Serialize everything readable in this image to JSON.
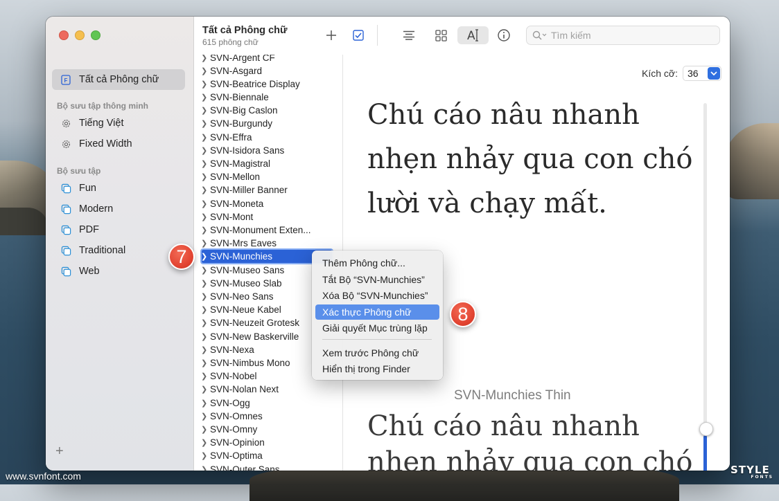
{
  "sidebar": {
    "all_fonts": "Tất cả Phông chữ",
    "smart_header": "Bộ sưu tập thông minh",
    "smart_items": [
      "Tiếng Việt",
      "Fixed Width"
    ],
    "collections_header": "Bộ sưu tập",
    "collections": [
      "Fun",
      "Modern",
      "PDF",
      "Traditional",
      "Web"
    ],
    "add_label": "+"
  },
  "toolbar": {
    "title": "Tất cả Phông chữ",
    "subtitle": "615 phông chữ",
    "search_placeholder": "Tìm kiếm"
  },
  "font_list": [
    "SVN-Argent CF",
    "SVN-Asgard",
    "SVN-Beatrice Display",
    "SVN-Biennale",
    "SVN-Big Caslon",
    "SVN-Burgundy",
    "SVN-Effra",
    "SVN-Isidora Sans",
    "SVN-Magistral",
    "SVN-Mellon",
    "SVN-Miller Banner",
    "SVN-Moneta",
    "SVN-Mont",
    "SVN-Monument Exten...",
    "SVN-Mrs Eaves",
    "SVN-Munchies",
    "SVN-Museo Sans",
    "SVN-Museo Slab",
    "SVN-Neo Sans",
    "SVN-Neue Kabel",
    "SVN-Neuzeit Grotesk",
    "SVN-New Baskerville",
    "SVN-Nexa",
    "SVN-Nimbus Mono",
    "SVN-Nobel",
    "SVN-Nolan Next",
    "SVN-Ogg",
    "SVN-Omnes",
    "SVN-Omny",
    "SVN-Opinion",
    "SVN-Optima",
    "SVN-Outer Sans"
  ],
  "selected_font": "SVN-Munchies",
  "preview": {
    "size_label": "Kích cỡ:",
    "size_value": "36",
    "sample_lines": [
      "Chú cáo nâu nhanh",
      "nhẹn nhảy qua con chó",
      "lười và chạy mất."
    ],
    "section_name": "SVN-Munchies Thin",
    "sample_lines_2": [
      "Chú cáo nâu nhanh",
      "nhẹn nhảy qua con chó"
    ]
  },
  "context_menu": {
    "items": [
      "Thêm Phông chữ...",
      "Tắt Bộ “SVN-Munchies”",
      "Xóa Bộ “SVN-Munchies”",
      "Xác thực Phông chữ",
      "Giải quyết Mục trùng lặp",
      "Xem trước Phông chữ",
      "Hiển thị trong Finder"
    ],
    "highlighted": "Xác thực Phông chữ"
  },
  "callouts": [
    "7",
    "8"
  ],
  "watermark": {
    "site": "www.svnfont.com",
    "logo": "STYLE",
    "logo_sub": "FONTS"
  },
  "colors": {
    "accent": "#2b62d6",
    "menu_highlight": "#5a8fea",
    "callout": "#e34533"
  }
}
